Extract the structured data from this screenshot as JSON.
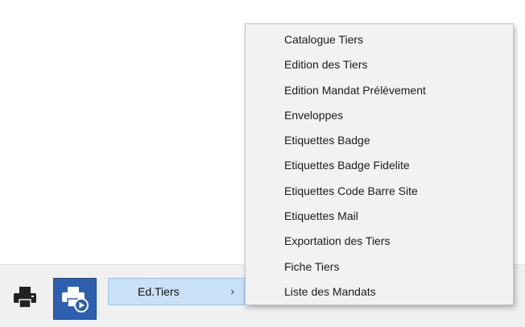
{
  "toolbar": {
    "printer_icon": "printer-icon",
    "edition_icon": "printer-play-icon",
    "accent_color": "#2d5fae"
  },
  "submenu": {
    "label": "Ed.Tiers",
    "chevron": "›",
    "highlight_color": "#c9e0f7"
  },
  "menu": {
    "items": [
      "Catalogue Tiers",
      "Edition des Tiers",
      "Edition Mandat Prélèvement",
      "Enveloppes",
      "Etiquettes Badge",
      "Etiquettes Badge Fidelite",
      "Etiquettes Code Barre Site",
      "Etiquettes Mail",
      "Exportation des Tiers",
      "Fiche Tiers",
      "Liste des Mandats"
    ]
  }
}
